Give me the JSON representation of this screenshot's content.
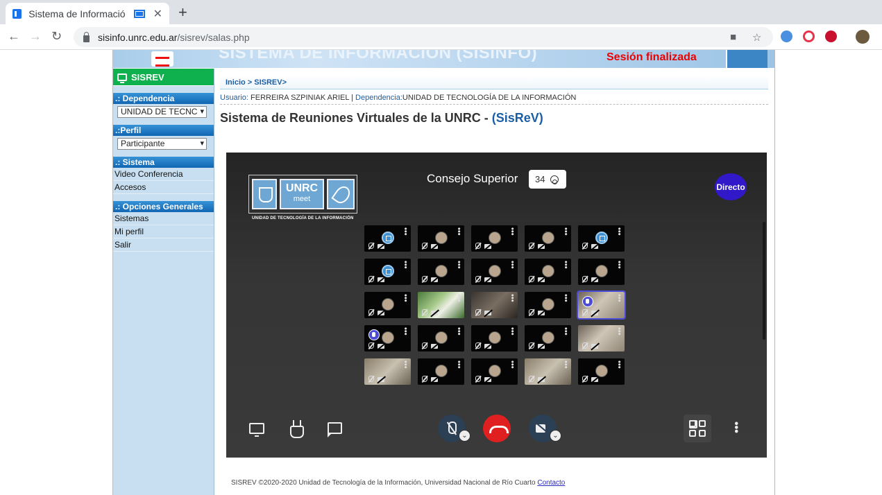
{
  "browser": {
    "tab_title": "Sistema de Informació",
    "url_host": "sisinfo.unrc.edu.ar",
    "url_path": "/sisrev/salas.php"
  },
  "banner": {
    "title_partial": "SISTEMA DE INFORMACIÓN (SISINFO)",
    "session_status": "Sesión finalizada",
    "status_color": "#e00000"
  },
  "sidebar": {
    "app_label": "SISREV",
    "dependencia_header": ".: Dependencia",
    "dependencia_value": "UNIDAD DE TECNC",
    "perfil_header": ".:Perfil",
    "perfil_value": "Participante",
    "sistema_header": ".: Sistema",
    "sistema_items": [
      "Video Conferencia",
      "Accesos"
    ],
    "opciones_header": ".: Opciones Generales",
    "opciones_items": [
      "Sistemas",
      "Mi perfil",
      "Salir"
    ]
  },
  "content": {
    "breadcrumb": "Inicio > SISREV>",
    "user_label": "Usuario:",
    "user_value": "FERREIRA SZPINIAK ARIEL |",
    "dep_label": "Dependencia:",
    "dep_value": "UNIDAD DE TECNOLOGÍA DE LA INFORMACIÓN",
    "title_main": "Sistema de Reuniones Virtuales de la UNRC - ",
    "title_accent": "(SisReV)"
  },
  "meeting": {
    "logo_word": "UNRC",
    "logo_sub": "meet",
    "logo_caption": "UNIDAD DE TECNOLOGÍA DE LA INFORMACIÓN",
    "room_name": "Consejo Superior",
    "participant_count": "34",
    "live_label": "Directo",
    "tiles": [
      "logo",
      "avatar",
      "avatar",
      "avatar",
      "logo",
      "logo",
      "avatar",
      "avatar",
      "avatar",
      "avatar",
      "avatar",
      "video-green",
      "video-dark",
      "avatar",
      "video-active",
      "hand",
      "avatar",
      "avatar",
      "avatar",
      "video-wall",
      "video",
      "avatar",
      "avatar",
      "video",
      "avatar"
    ]
  },
  "footer": {
    "text": "SISREV  ©2020-2020 Unidad de Tecnología de la Información, Universidad Nacional de Río Cuarto ",
    "link": "Contacto"
  },
  "colors": {
    "accent_blue": "#1a5fa6",
    "green_header": "#0fb14e",
    "hangup_red": "#e02020",
    "live_purple": "#3119c9"
  }
}
